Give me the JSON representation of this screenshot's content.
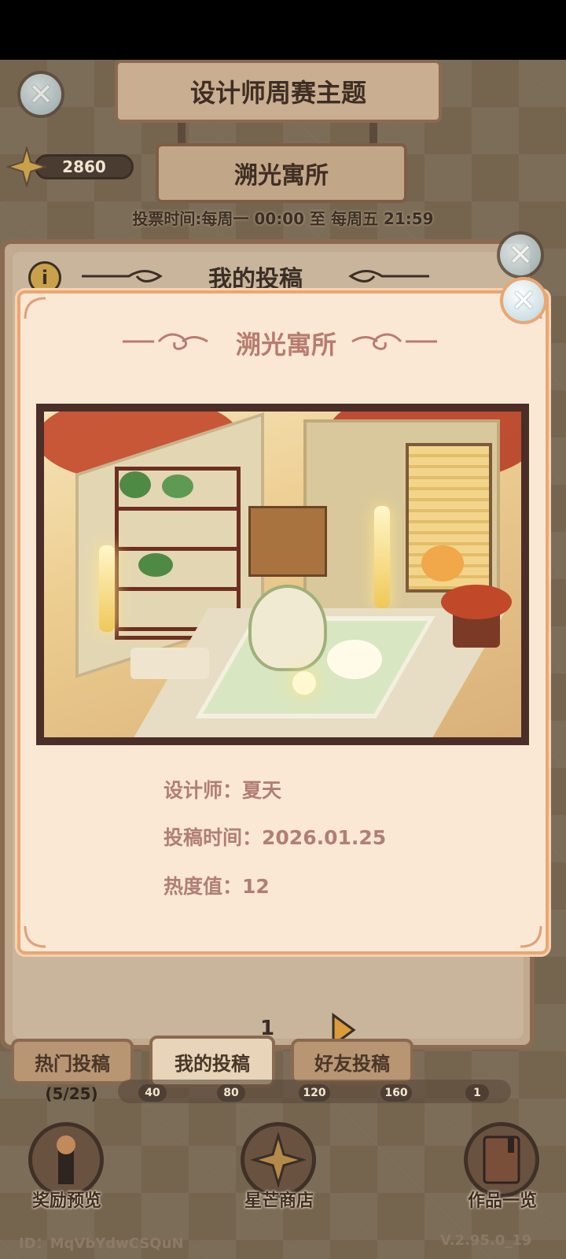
{
  "header": {
    "weekly_theme_title": "设计师周赛主题",
    "theme_name": "溯光寓所",
    "vote_time": "投票时间:每周一 00:00 至 每周五 21:59",
    "star_count": "2860"
  },
  "panel": {
    "title": "我的投稿",
    "page_number": "1"
  },
  "tabs": [
    {
      "label": "热门投稿"
    },
    {
      "label": "我的投稿"
    },
    {
      "label": "好友投稿"
    }
  ],
  "progress": {
    "count": "(5/25)",
    "milestones": [
      "40",
      "80",
      "120",
      "160",
      "1"
    ]
  },
  "bottom_nav": [
    {
      "label": "奖励预览"
    },
    {
      "label": "星芒商店"
    },
    {
      "label": "作品一览"
    }
  ],
  "footer": {
    "id": "ID：MqVbYdwCSQuN",
    "version": "V.2.95.0_19"
  },
  "modal": {
    "title": "溯光寓所",
    "designer_label": "设计师：",
    "designer": "夏天",
    "time_label": "投稿时间：",
    "time": "2026.01.25",
    "heat_label": "热度值：",
    "heat": "12"
  },
  "colors": {
    "modal_bg": "#fbe8d4",
    "modal_border": "#e9a774",
    "modal_text": "#b07f73",
    "frame": "#4b2e27"
  }
}
